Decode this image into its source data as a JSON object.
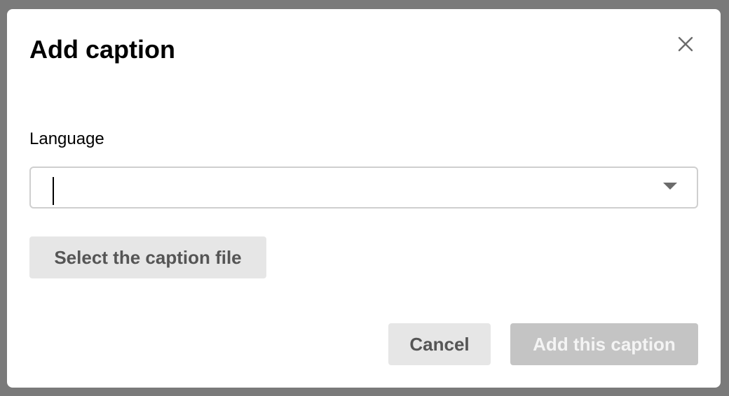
{
  "dialog": {
    "title": "Add caption"
  },
  "language_field": {
    "label": "Language",
    "value": "",
    "placeholder": ""
  },
  "buttons": {
    "select_file_label": "Select the caption file",
    "cancel_label": "Cancel",
    "add_label": "Add this caption"
  },
  "icons": {
    "close": "close-icon",
    "dropdown": "chevron-down-icon"
  },
  "colors": {
    "backdrop": "#7a7a7a",
    "dialog_bg": "#ffffff",
    "secondary_button_bg": "#e6e6e6",
    "disabled_button_bg": "#c4c4c4"
  }
}
